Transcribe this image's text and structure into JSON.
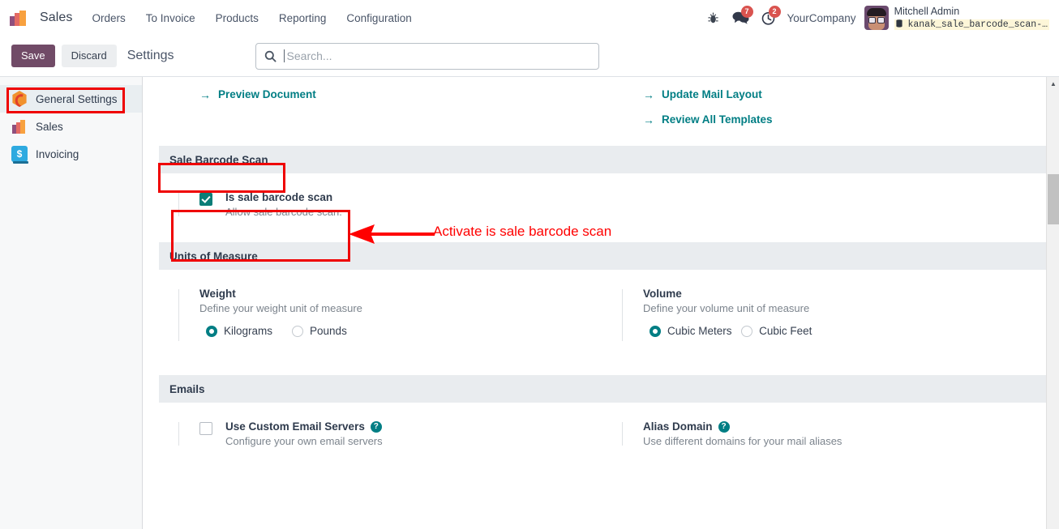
{
  "navbar": {
    "brand": "Sales",
    "logo_icon": "sales-bars-logo",
    "menu": [
      {
        "label": "Orders"
      },
      {
        "label": "To Invoice"
      },
      {
        "label": "Products"
      },
      {
        "label": "Reporting"
      },
      {
        "label": "Configuration"
      }
    ],
    "system_icons": [
      {
        "name": "bug-icon",
        "glyph": "🐞",
        "badge": ""
      },
      {
        "name": "messages-icon",
        "glyph": "💬",
        "badge": "7"
      },
      {
        "name": "activities-clock-icon",
        "glyph": "◴",
        "badge": "2"
      }
    ],
    "company": "YourCompany",
    "user_name": "Mitchell Admin",
    "database": "kanak_sale_barcode_scan-…",
    "database_icon": "database-icon",
    "avatar_icon": "user-avatar"
  },
  "controlpanel": {
    "save_label": "Save",
    "discard_label": "Discard",
    "title": "Settings",
    "search_icon": "search-icon",
    "search_value": "",
    "search_placeholder": "Search..."
  },
  "sidebar": {
    "items": [
      {
        "label": "General Settings",
        "icon": "general-settings-icon",
        "active": true
      },
      {
        "label": "Sales",
        "icon": "sales-icon",
        "active": false
      },
      {
        "label": "Invoicing",
        "icon": "invoicing-icon",
        "active": false
      }
    ]
  },
  "content": {
    "top_links": {
      "left": [
        {
          "label": "Preview Document",
          "icon": "arrow-right-icon"
        }
      ],
      "right": [
        {
          "label": "Update Mail Layout",
          "icon": "arrow-right-icon"
        },
        {
          "label": "Review All Templates",
          "icon": "arrow-right-icon"
        }
      ]
    },
    "sections": [
      {
        "title": "Sale Barcode Scan",
        "setting": {
          "label": "Is sale barcode scan",
          "description": "Allow sale barcode scan.",
          "checked": true
        }
      },
      {
        "title": "Units of Measure",
        "weight": {
          "title": "Weight",
          "description": "Define your weight unit of measure",
          "options": [
            {
              "label": "Kilograms",
              "selected": true
            },
            {
              "label": "Pounds",
              "selected": false
            }
          ]
        },
        "volume": {
          "title": "Volume",
          "description": "Define your volume unit of measure",
          "options": [
            {
              "label": "Cubic Meters",
              "selected": true
            },
            {
              "label": "Cubic Feet",
              "selected": false
            }
          ]
        }
      },
      {
        "title": "Emails",
        "custom_servers": {
          "label": "Use Custom Email Servers",
          "description": "Configure your own email servers",
          "checked": false,
          "help_icon": "help-circle-icon"
        },
        "alias_domain": {
          "label": "Alias Domain",
          "description": "Use different domains for your mail aliases",
          "help_icon": "help-circle-icon"
        }
      }
    ]
  },
  "scrollbar": {
    "up_arrow_icon": "scroll-up-arrow-icon",
    "thumb": "scroll-thumb"
  },
  "annotations": {
    "callout_text": "Activate is sale barcode scan",
    "color": "#ff0000"
  }
}
